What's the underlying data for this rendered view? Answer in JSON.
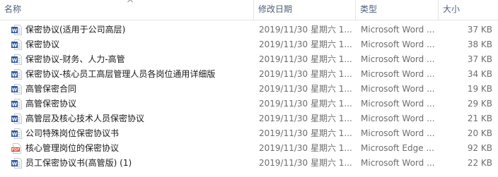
{
  "header": {
    "name": "名称",
    "date": "修改日期",
    "type": "类型",
    "size": "大小"
  },
  "colors": {
    "word_icon": "#2b579a",
    "pdf_icon": "#d9382b",
    "header_text": "#4c607a"
  },
  "files": [
    {
      "name": "保密协议(适用于公司高层)",
      "date": "2019/11/30 星期六 1...",
      "type": "Microsoft Word ...",
      "size": "37 KB",
      "icon": "word-doc-icon"
    },
    {
      "name": "保密协议",
      "date": "2019/11/30 星期六 1...",
      "type": "Microsoft Word ...",
      "size": "38 KB",
      "icon": "word-doc-icon"
    },
    {
      "name": "保密协议-财务、人力-高管",
      "date": "2019/11/30 星期六 1...",
      "type": "Microsoft Word ...",
      "size": "37 KB",
      "icon": "word-doc-icon"
    },
    {
      "name": "保密协议-核心员工高层管理人员各岗位通用详细版",
      "date": "2019/11/30 星期六 1...",
      "type": "Microsoft Word ...",
      "size": "34 KB",
      "icon": "word-doc-icon"
    },
    {
      "name": "高管保密合同",
      "date": "2019/11/30 星期六 1...",
      "type": "Microsoft Word ...",
      "size": "19 KB",
      "icon": "word-doc-icon"
    },
    {
      "name": "高管保密协议",
      "date": "2019/11/30 星期六 1...",
      "type": "Microsoft Word ...",
      "size": "29 KB",
      "icon": "word-doc-icon"
    },
    {
      "name": "高管层及核心技术人员保密协议",
      "date": "2019/11/30 星期六 1...",
      "type": "Microsoft Word ...",
      "size": "21 KB",
      "icon": "word-doc-icon"
    },
    {
      "name": "公司特殊岗位保密协议书",
      "date": "2019/11/30 星期六 1...",
      "type": "Microsoft Word ...",
      "size": "20 KB",
      "icon": "word-doc-icon"
    },
    {
      "name": "核心管理岗位的保密协议",
      "date": "2019/11/30 星期六 1...",
      "type": "Microsoft Edge ...",
      "size": "92 KB",
      "icon": "pdf-icon"
    },
    {
      "name": "员工保密协议书(高管版) (1)",
      "date": "2019/11/30 星期六 1...",
      "type": "Microsoft Word ...",
      "size": "22 KB",
      "icon": "word-doc-icon"
    }
  ]
}
